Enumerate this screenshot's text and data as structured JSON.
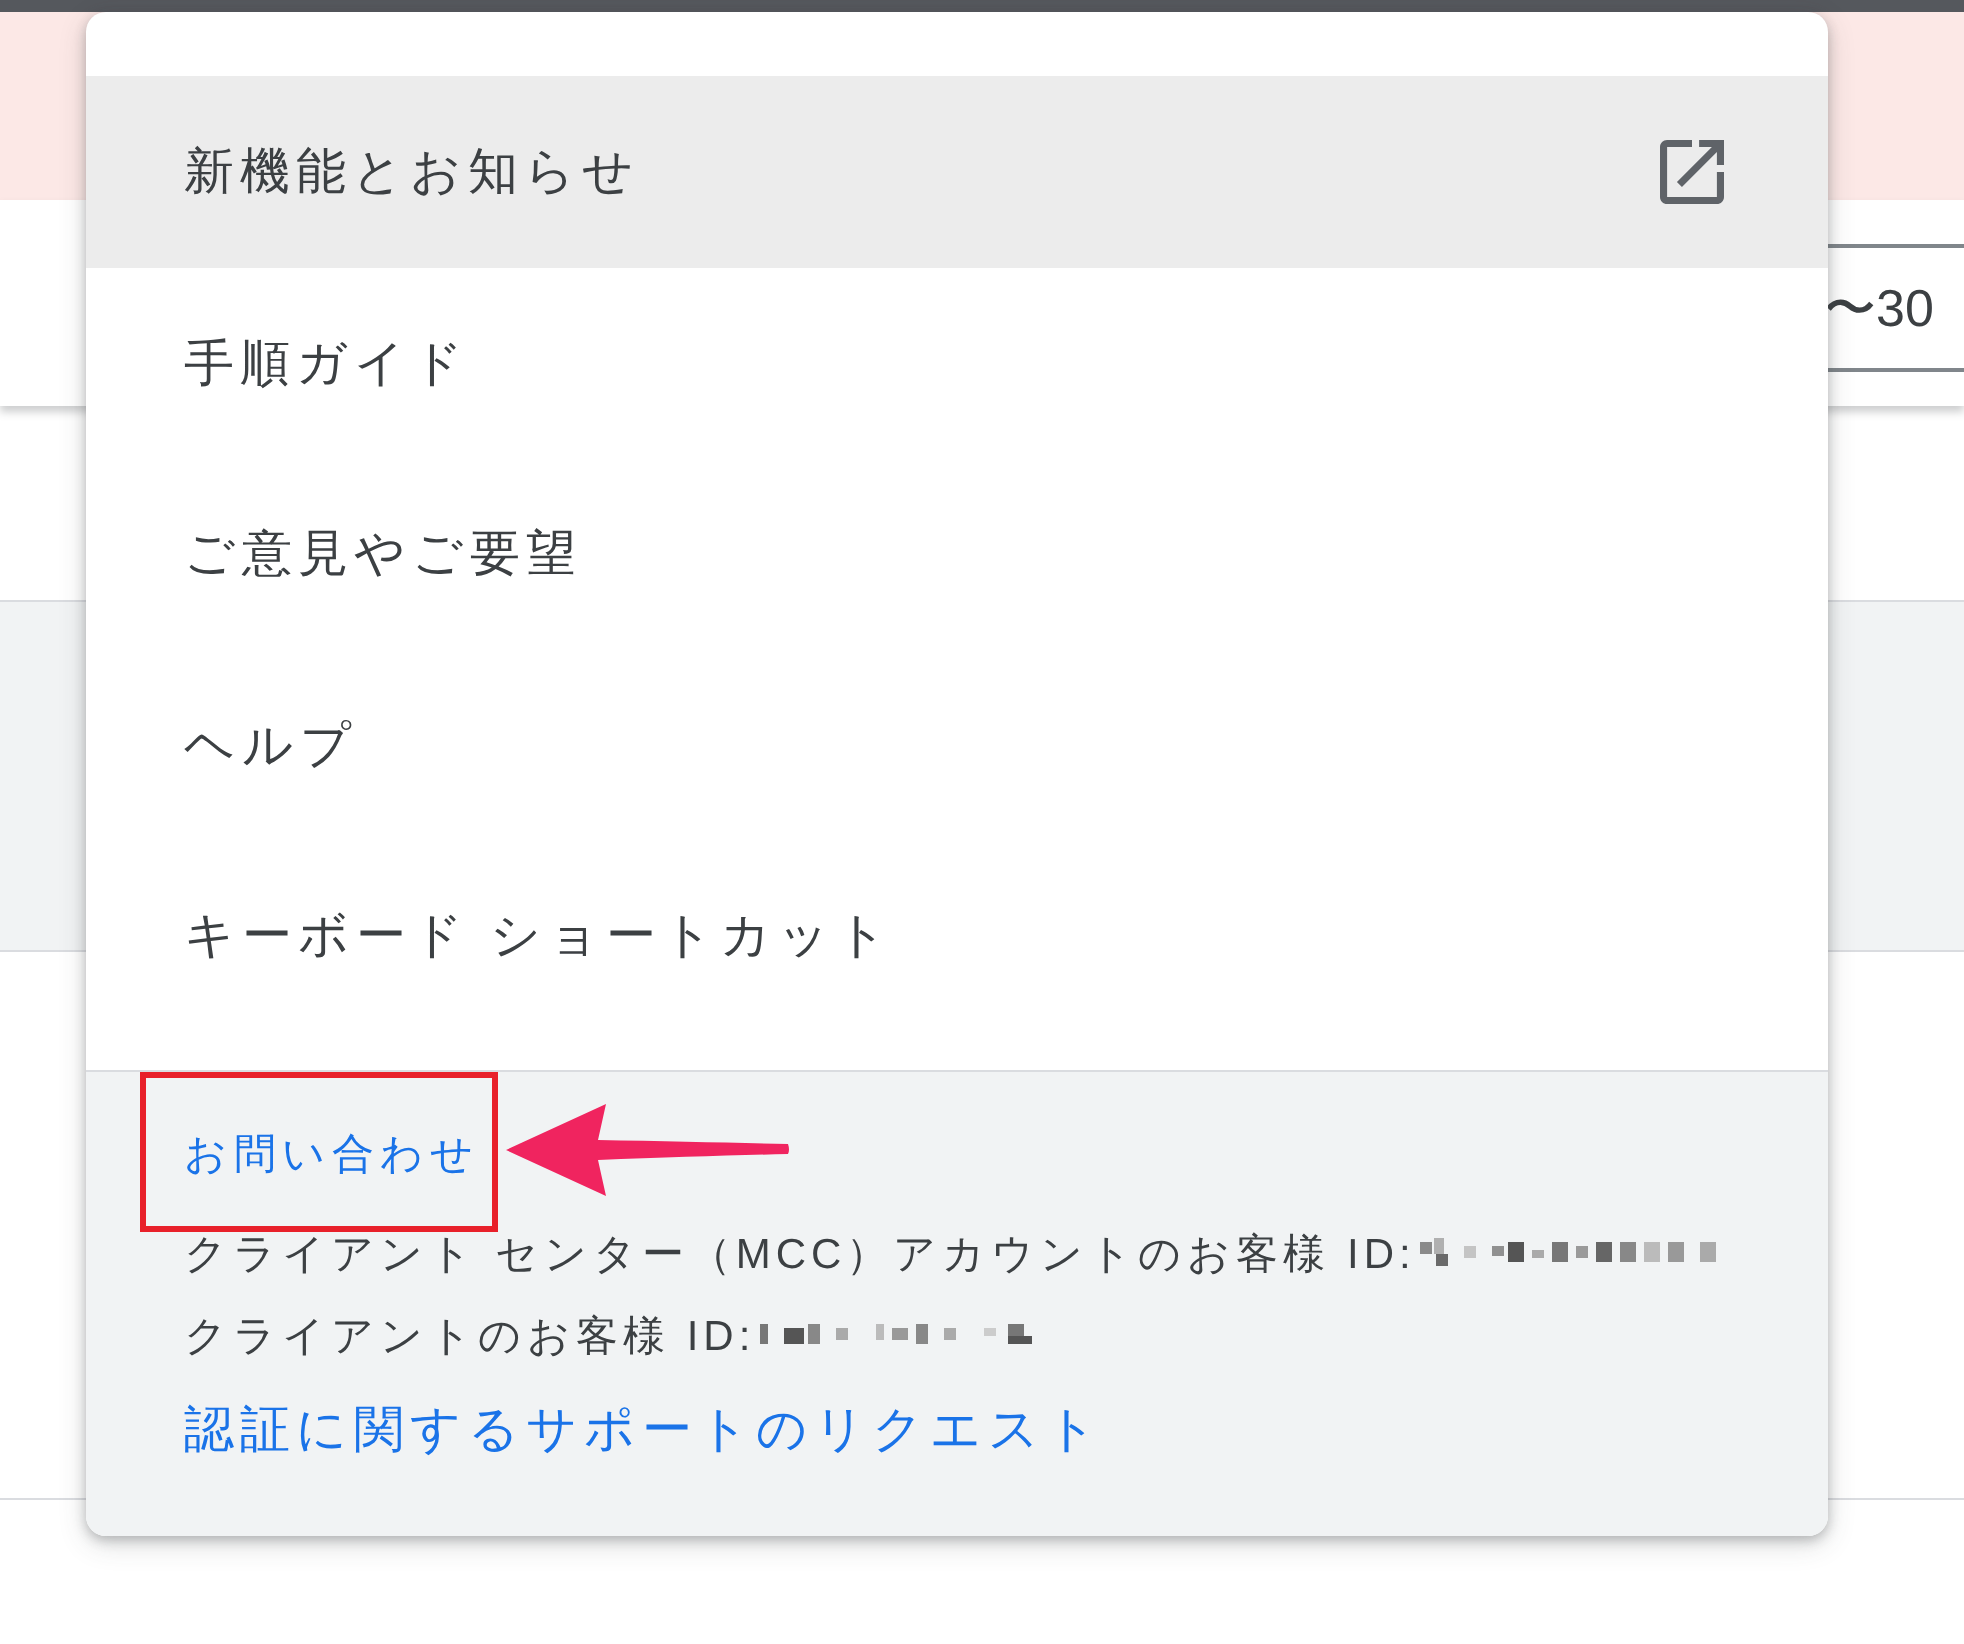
{
  "background": {
    "date_range_field": {
      "value": "〜30"
    }
  },
  "menu": {
    "items": [
      {
        "label": "新機能とお知らせ",
        "selected": true,
        "external": true
      },
      {
        "label": "手順ガイド",
        "selected": false,
        "external": false
      },
      {
        "label": "ご意見やご要望",
        "selected": false,
        "external": false
      },
      {
        "label": "ヘルプ",
        "selected": false,
        "external": false
      },
      {
        "label": "キーボード ショートカット",
        "selected": false,
        "external": false
      }
    ]
  },
  "footer": {
    "contact_link": {
      "label": "お問い合わせ",
      "highlighted": true
    },
    "account_lines": [
      {
        "label": "クライアント センター（MCC）アカウントのお客様 ID:",
        "redacted": true
      },
      {
        "label": "クライアントのお客様 ID:",
        "redacted": true
      }
    ],
    "request_link": {
      "label": "認証に関するサポートのリクエスト"
    }
  }
}
